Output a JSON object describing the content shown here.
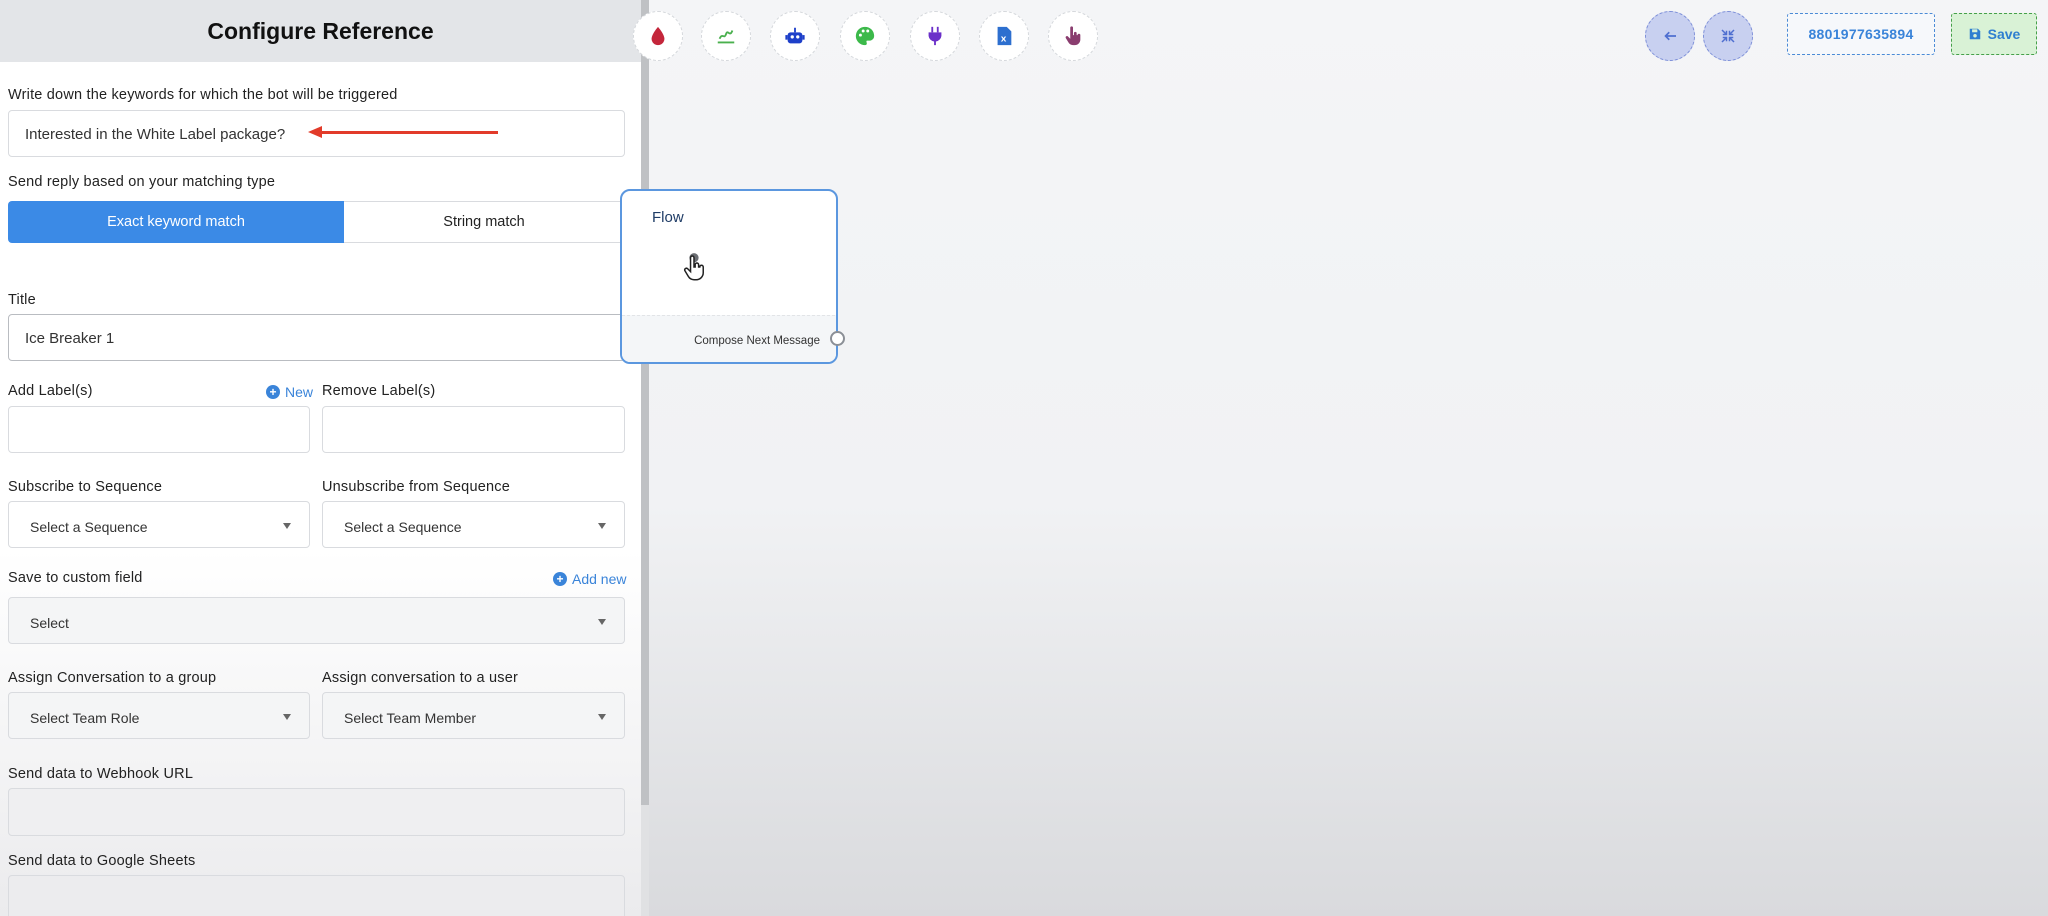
{
  "panel": {
    "title": "Configure Reference",
    "keywords": {
      "label": "Write down the keywords for which the bot will be triggered",
      "value": "Interested in the White Label package?"
    },
    "matching": {
      "label": "Send reply based on your matching type",
      "options": [
        "Exact keyword match",
        "String match"
      ],
      "selected": "Exact keyword match"
    },
    "title_field": {
      "label": "Title",
      "value": "Ice Breaker 1"
    },
    "add_labels": {
      "label": "Add Label(s)",
      "new_link": "New"
    },
    "remove_labels": {
      "label": "Remove Label(s)"
    },
    "subscribe": {
      "label": "Subscribe to Sequence",
      "value": "Select a Sequence"
    },
    "unsubscribe": {
      "label": "Unsubscribe from Sequence",
      "value": "Select a Sequence"
    },
    "custom_field": {
      "label": "Save to custom field",
      "add_link": "Add new",
      "value": "Select"
    },
    "assign_group": {
      "label": "Assign Conversation to a group",
      "value": "Select Team Role"
    },
    "assign_user": {
      "label": "Assign conversation to a user",
      "value": "Select Team Member"
    },
    "webhook": {
      "label": "Send data to Webhook URL"
    },
    "sheets": {
      "label": "Send data to Google Sheets"
    }
  },
  "toolbar": {
    "icons": [
      "drop-icon",
      "signature-icon",
      "robot-icon",
      "palette-icon",
      "plug-icon",
      "excel-file-icon",
      "pointer-hand-icon"
    ],
    "back_icon": "arrow-left-icon",
    "fit_icon": "compress-icon",
    "phone": "8801977635894",
    "save_label": "Save"
  },
  "node": {
    "title": "Flow",
    "footer": "Compose Next Message"
  },
  "colors": {
    "accent": "#3b8ae6",
    "annotation_arrow": "#e23b2a",
    "save_bg": "#d9f2d6"
  }
}
